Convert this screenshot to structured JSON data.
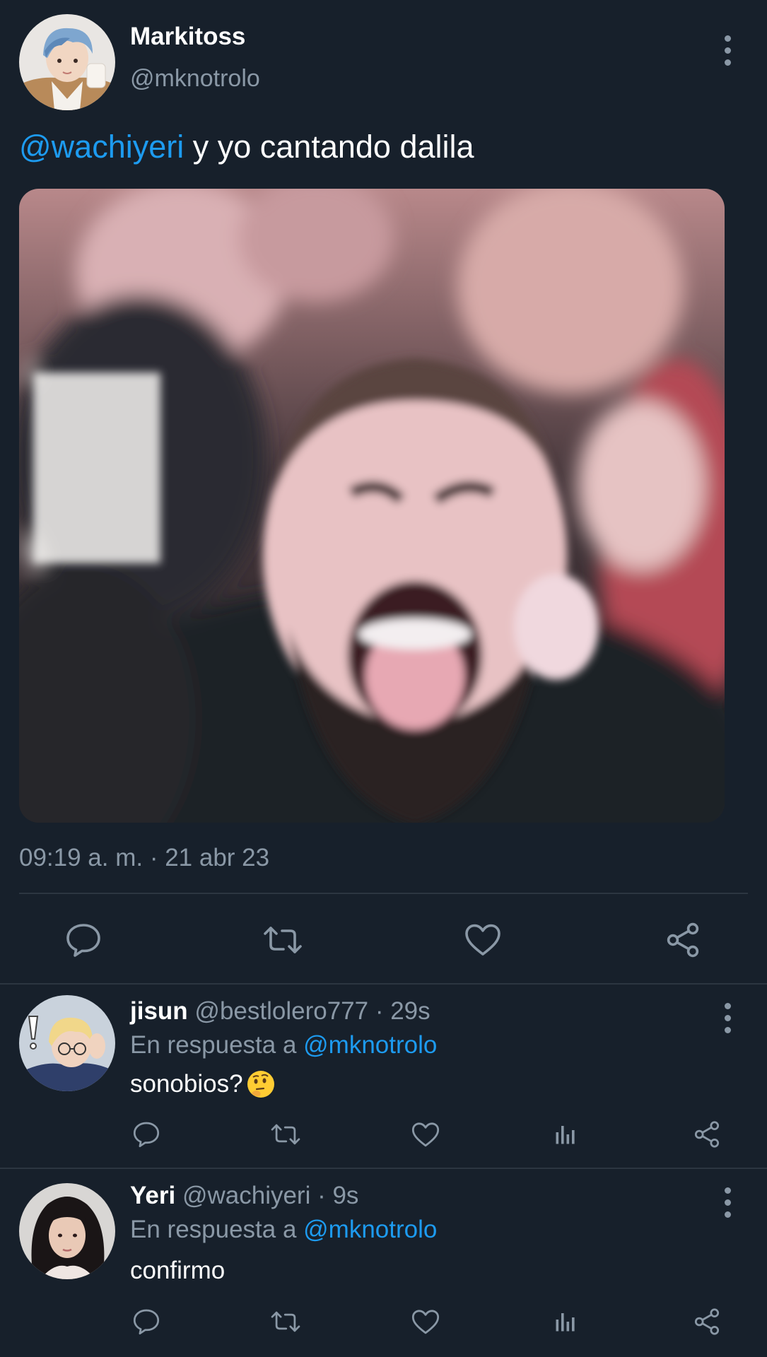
{
  "main_tweet": {
    "author_name": "Markitoss",
    "author_handle": "@mknotrolo",
    "mention": "@wachiyeri",
    "text": " y yo cantando dalila",
    "timestamp": "09:19 a. m. · 21 abr 23"
  },
  "replies": [
    {
      "name": "jisun",
      "handle_time": " @bestlolero777 · 29s",
      "reply_prefix": "En respuesta a ",
      "reply_mention": "@mknotrolo",
      "text": "sonobios?",
      "emoji": "thinking-face"
    },
    {
      "name": "Yeri",
      "handle_time": " @wachiyeri · 9s",
      "reply_prefix": "En respuesta a ",
      "reply_mention": "@mknotrolo",
      "text": "confirmo"
    }
  ],
  "icons": {
    "reply": "reply-icon",
    "retweet": "retweet-icon",
    "like": "heart-icon",
    "share": "share-icon",
    "views": "views-icon",
    "more": "more-vertical-icon"
  },
  "colors": {
    "background": "#17202b",
    "accent": "#1d9bf0",
    "muted": "#8a98a6",
    "divider": "#2c3641"
  }
}
